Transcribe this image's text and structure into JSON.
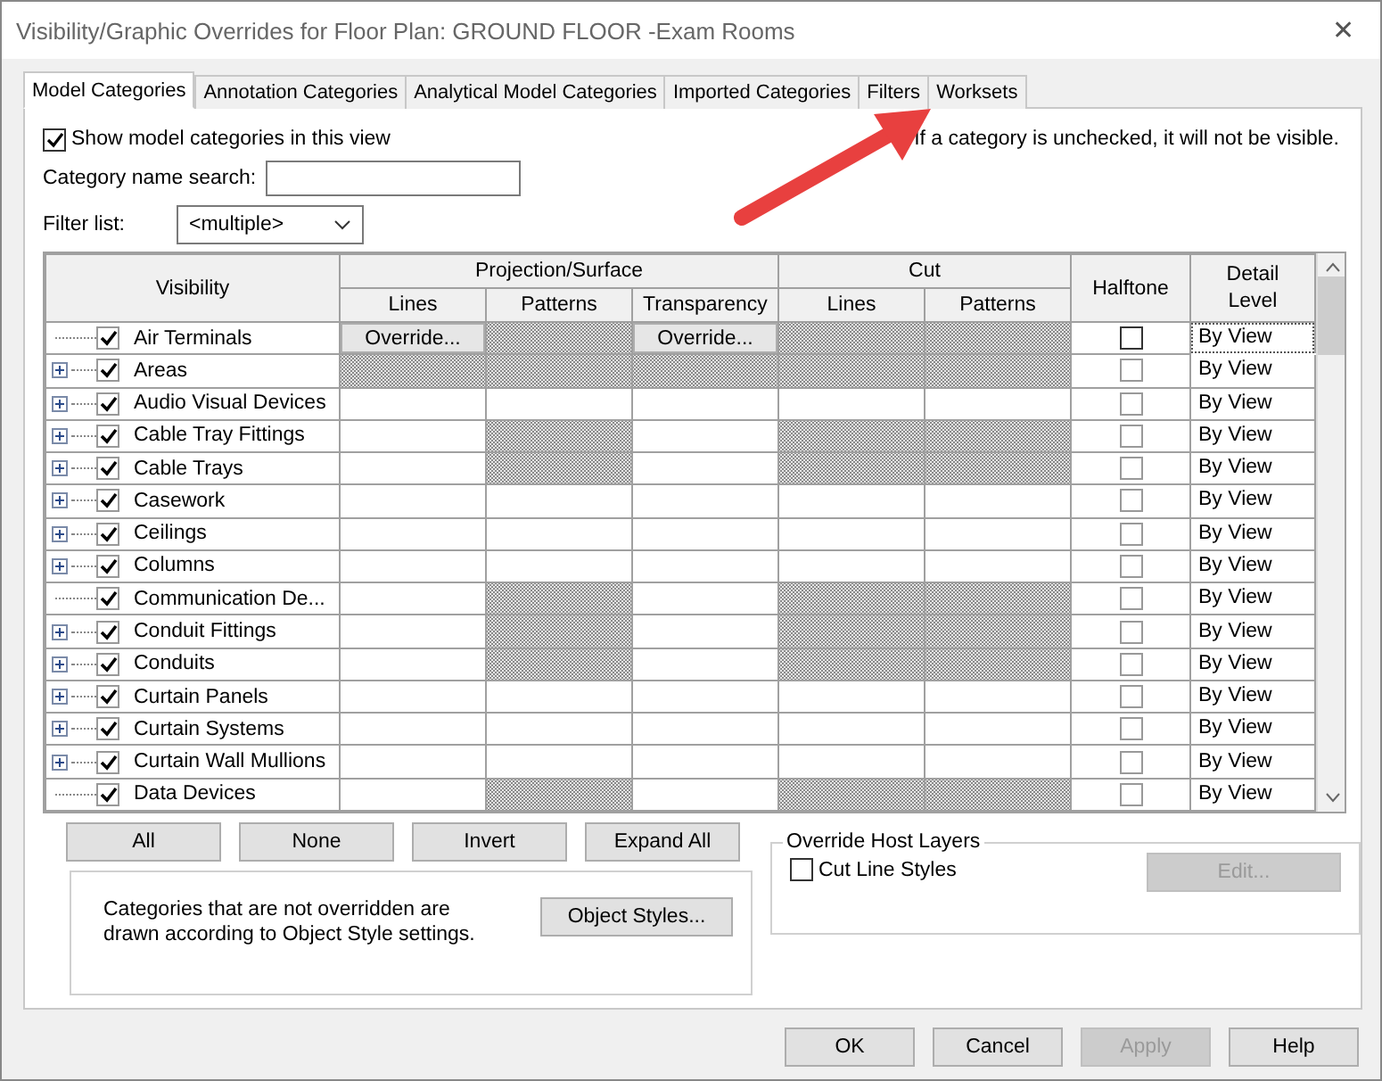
{
  "window": {
    "title": "Visibility/Graphic Overrides for Floor Plan: GROUND FLOOR -Exam Rooms",
    "close": "✕"
  },
  "tabs": [
    {
      "label": "Model Categories",
      "selected": true
    },
    {
      "label": "Annotation Categories",
      "selected": false
    },
    {
      "label": "Analytical Model Categories",
      "selected": false
    },
    {
      "label": "Imported Categories",
      "selected": false
    },
    {
      "label": "Filters",
      "selected": false
    },
    {
      "label": "Worksets",
      "selected": false
    }
  ],
  "show_categories": {
    "label": "Show model categories in this view",
    "checked": true
  },
  "hint": "If a category is unchecked, it will not be visible.",
  "search": {
    "label": "Category name search:"
  },
  "filter": {
    "label": "Filter list:",
    "value": "<multiple>"
  },
  "table": {
    "headers": {
      "visibility": "Visibility",
      "projection": "Projection/Surface",
      "cut": "Cut",
      "halftone": "Halftone",
      "detail": "Detail Level"
    },
    "projection_columns": [
      "Lines",
      "Patterns",
      "Transparency"
    ],
    "cut_columns": [
      "Lines",
      "Patterns"
    ],
    "rows": [
      {
        "name": "Air Terminals",
        "expandable": false,
        "checked": true,
        "selected": true,
        "cells": [
          {
            "kind": "override",
            "label": "Override..."
          },
          {
            "kind": "hatched"
          },
          {
            "kind": "override",
            "label": "Override..."
          },
          {
            "kind": "hatched"
          },
          {
            "kind": "hatched"
          }
        ],
        "halftone": false,
        "detail": "By View"
      },
      {
        "name": "Areas",
        "expandable": true,
        "checked": true,
        "selected": false,
        "cells": [
          {
            "kind": "hatched"
          },
          {
            "kind": "hatched"
          },
          {
            "kind": "hatched"
          },
          {
            "kind": "hatched"
          },
          {
            "kind": "hatched"
          }
        ],
        "halftone": false,
        "detail": "By View"
      },
      {
        "name": "Audio Visual Devices",
        "expandable": true,
        "checked": true,
        "selected": false,
        "cells": [
          {
            "kind": "blank"
          },
          {
            "kind": "blank"
          },
          {
            "kind": "blank"
          },
          {
            "kind": "blank"
          },
          {
            "kind": "blank"
          }
        ],
        "halftone": false,
        "detail": "By View"
      },
      {
        "name": "Cable Tray Fittings",
        "expandable": true,
        "checked": true,
        "selected": false,
        "cells": [
          {
            "kind": "blank"
          },
          {
            "kind": "hatched"
          },
          {
            "kind": "blank"
          },
          {
            "kind": "hatched"
          },
          {
            "kind": "hatched"
          }
        ],
        "halftone": false,
        "detail": "By View"
      },
      {
        "name": "Cable Trays",
        "expandable": true,
        "checked": true,
        "selected": false,
        "cells": [
          {
            "kind": "blank"
          },
          {
            "kind": "hatched"
          },
          {
            "kind": "blank"
          },
          {
            "kind": "hatched"
          },
          {
            "kind": "hatched"
          }
        ],
        "halftone": false,
        "detail": "By View"
      },
      {
        "name": "Casework",
        "expandable": true,
        "checked": true,
        "selected": false,
        "cells": [
          {
            "kind": "blank"
          },
          {
            "kind": "blank"
          },
          {
            "kind": "blank"
          },
          {
            "kind": "blank"
          },
          {
            "kind": "blank"
          }
        ],
        "halftone": false,
        "detail": "By View"
      },
      {
        "name": "Ceilings",
        "expandable": true,
        "checked": true,
        "selected": false,
        "cells": [
          {
            "kind": "blank"
          },
          {
            "kind": "blank"
          },
          {
            "kind": "blank"
          },
          {
            "kind": "blank"
          },
          {
            "kind": "blank"
          }
        ],
        "halftone": false,
        "detail": "By View"
      },
      {
        "name": "Columns",
        "expandable": true,
        "checked": true,
        "selected": false,
        "cells": [
          {
            "kind": "blank"
          },
          {
            "kind": "blank"
          },
          {
            "kind": "blank"
          },
          {
            "kind": "blank"
          },
          {
            "kind": "blank"
          }
        ],
        "halftone": false,
        "detail": "By View"
      },
      {
        "name": "Communication De...",
        "expandable": false,
        "checked": true,
        "selected": false,
        "cells": [
          {
            "kind": "blank"
          },
          {
            "kind": "hatched"
          },
          {
            "kind": "blank"
          },
          {
            "kind": "hatched"
          },
          {
            "kind": "hatched"
          }
        ],
        "halftone": false,
        "detail": "By View"
      },
      {
        "name": "Conduit Fittings",
        "expandable": true,
        "checked": true,
        "selected": false,
        "cells": [
          {
            "kind": "blank"
          },
          {
            "kind": "hatched"
          },
          {
            "kind": "blank"
          },
          {
            "kind": "hatched"
          },
          {
            "kind": "hatched"
          }
        ],
        "halftone": false,
        "detail": "By View"
      },
      {
        "name": "Conduits",
        "expandable": true,
        "checked": true,
        "selected": false,
        "cells": [
          {
            "kind": "blank"
          },
          {
            "kind": "hatched"
          },
          {
            "kind": "blank"
          },
          {
            "kind": "hatched"
          },
          {
            "kind": "hatched"
          }
        ],
        "halftone": false,
        "detail": "By View"
      },
      {
        "name": "Curtain Panels",
        "expandable": true,
        "checked": true,
        "selected": false,
        "cells": [
          {
            "kind": "blank"
          },
          {
            "kind": "blank"
          },
          {
            "kind": "blank"
          },
          {
            "kind": "blank"
          },
          {
            "kind": "blank"
          }
        ],
        "halftone": false,
        "detail": "By View"
      },
      {
        "name": "Curtain Systems",
        "expandable": true,
        "checked": true,
        "selected": false,
        "cells": [
          {
            "kind": "blank"
          },
          {
            "kind": "blank"
          },
          {
            "kind": "blank"
          },
          {
            "kind": "blank"
          },
          {
            "kind": "blank"
          }
        ],
        "halftone": false,
        "detail": "By View"
      },
      {
        "name": "Curtain Wall Mullions",
        "expandable": true,
        "checked": true,
        "selected": false,
        "cells": [
          {
            "kind": "blank"
          },
          {
            "kind": "blank"
          },
          {
            "kind": "blank"
          },
          {
            "kind": "blank"
          },
          {
            "kind": "blank"
          }
        ],
        "halftone": false,
        "detail": "By View"
      },
      {
        "name": "Data Devices",
        "expandable": false,
        "checked": true,
        "selected": false,
        "cells": [
          {
            "kind": "blank"
          },
          {
            "kind": "hatched"
          },
          {
            "kind": "blank"
          },
          {
            "kind": "hatched"
          },
          {
            "kind": "hatched"
          }
        ],
        "halftone": false,
        "detail": "By View"
      }
    ]
  },
  "list_buttons": [
    "All",
    "None",
    "Invert",
    "Expand All"
  ],
  "note": "Categories that are not overridden are drawn according to Object Style settings.",
  "object_styles_button": "Object Styles...",
  "host_layers": {
    "title": "Override Host Layers",
    "cut_line_styles": {
      "label": "Cut Line Styles",
      "checked": false
    },
    "edit_button": {
      "label": "Edit...",
      "disabled": true
    }
  },
  "footer_buttons": [
    {
      "label": "OK",
      "disabled": false
    },
    {
      "label": "Cancel",
      "disabled": false
    },
    {
      "label": "Apply",
      "disabled": true
    },
    {
      "label": "Help",
      "disabled": false
    }
  ]
}
